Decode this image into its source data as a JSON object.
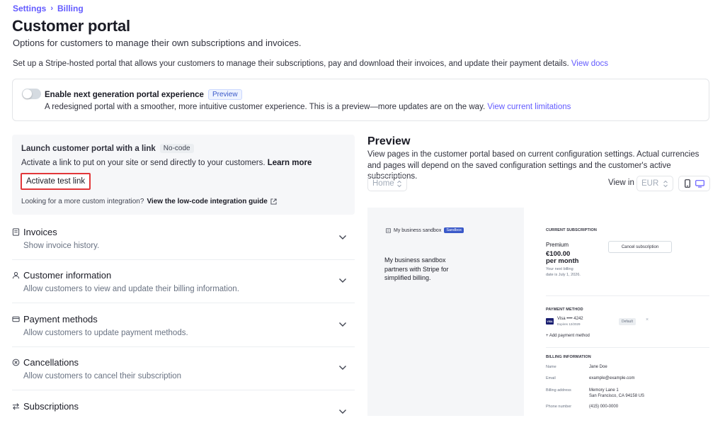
{
  "breadcrumb": {
    "settings": "Settings",
    "separator": "›",
    "billing": "Billing"
  },
  "page": {
    "title": "Customer portal",
    "subtitle": "Options for customers to manage their own subscriptions and invoices.",
    "intro": "Set up a Stripe-hosted portal that allows your customers to manage their subscriptions, pay and download their invoices, and update their payment details.",
    "intro_link": "View docs"
  },
  "nextgen": {
    "title": "Enable next generation portal experience",
    "badge": "Preview",
    "description": "A redesigned portal with a smoother, more intuitive customer experience. This is a preview—more updates are on the way.",
    "link": "View current limitations",
    "toggle_on": false
  },
  "launch": {
    "title": "Launch customer portal with a link",
    "badge": "No-code",
    "description": "Activate a link to put on your site or send directly to your customers.",
    "learn_more": "Learn more",
    "button": "Activate test link",
    "lowcode_text": "Looking for a more custom integration?",
    "lowcode_link": "View the low-code integration guide"
  },
  "sections": [
    {
      "title": "Invoices",
      "description": "Show invoice history.",
      "icon": "invoice-icon"
    },
    {
      "title": "Customer information",
      "description": "Allow customers to view and update their billing information.",
      "icon": "person-icon"
    },
    {
      "title": "Payment methods",
      "description": "Allow customers to update payment methods.",
      "icon": "card-icon"
    },
    {
      "title": "Cancellations",
      "description": "Allow customers to cancel their subscription",
      "icon": "cancel-circle-icon"
    },
    {
      "title": "Subscriptions",
      "description": "",
      "icon": "swap-arrows-icon"
    }
  ],
  "preview": {
    "title": "Preview",
    "description": "View pages in the customer portal based on current configuration settings. Actual currencies and pages will depend on the saved configuration settings and the customer's active subscriptions.",
    "page_select": "Home",
    "view_in_label": "View in",
    "currency_select": "EUR",
    "device_selected": "desktop"
  },
  "mock": {
    "business_name": "My business sandbox",
    "sandbox_badge": "Sandbox",
    "tagline": "My business sandbox partners with Stripe for simplified billing.",
    "current_subscription_label": "CURRENT SUBSCRIPTION",
    "plan": "Premium",
    "price_amount": "€100.00",
    "price_period": "per month",
    "next_billing": "Your next billing date is July 1, 2026.",
    "cancel_button": "Cancel subscription",
    "payment_method_label": "PAYMENT METHOD",
    "card_brand": "VISA",
    "card_text": "Visa •••• 4242",
    "card_expiry": "Expires 12/2029",
    "default_badge": "Default",
    "remove_glyph": "×",
    "add_payment": "+ Add payment method",
    "billing_info_label": "BILLING INFORMATION",
    "name_label": "Name",
    "name_value": "Jane Doe",
    "email_label": "Email",
    "email_value": "example@example.com",
    "address_label": "Billing address",
    "address_line1": "Memory Lane 1",
    "address_line2": "San Francisco, CA 94158 US",
    "phone_label": "Phone number",
    "phone_value": "(415) 000-0000"
  },
  "colors": {
    "accent": "#635bff",
    "highlight_border": "#e2373a",
    "panel_bg": "#f6f7f9"
  }
}
